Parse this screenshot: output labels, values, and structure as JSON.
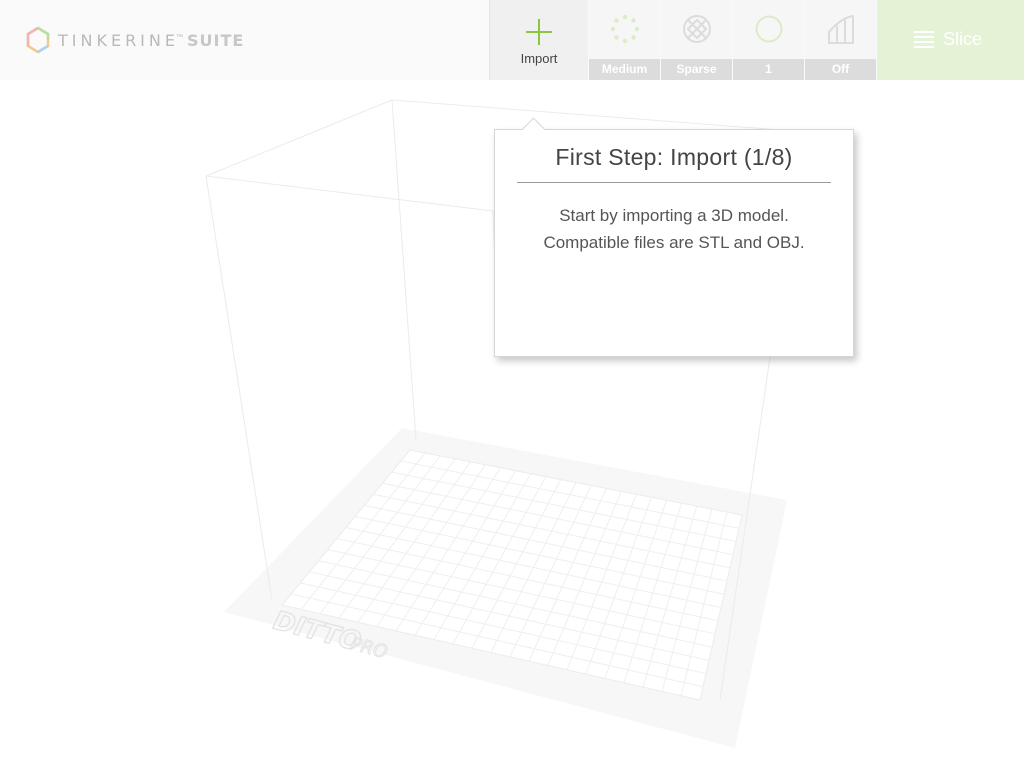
{
  "app": {
    "brand_name": "TINKERINE",
    "brand_tm": "™",
    "brand_suite": "SUITE"
  },
  "toolbar": {
    "import_label": "Import",
    "settings": [
      {
        "name": "quality",
        "icon": "quality-dots-icon",
        "label": "Medium"
      },
      {
        "name": "infill",
        "icon": "infill-icon",
        "label": "Sparse"
      },
      {
        "name": "shells",
        "icon": "shells-circle-icon",
        "label": "1"
      },
      {
        "name": "support",
        "icon": "support-icon",
        "label": "Off"
      }
    ],
    "slice_label": "Slice"
  },
  "tooltip": {
    "title": "First Step: Import (1/8)",
    "line1": "Start by importing a 3D model.",
    "line2": "Compatible files are STL and OBJ."
  },
  "printer": {
    "model_logo_text": "DITTO",
    "model_logo_suffix": "PRO"
  },
  "colors": {
    "accent_green": "#8cc63f",
    "slice_bg": "#e4f3d6",
    "setting_label_bg": "#dcdcdc"
  }
}
